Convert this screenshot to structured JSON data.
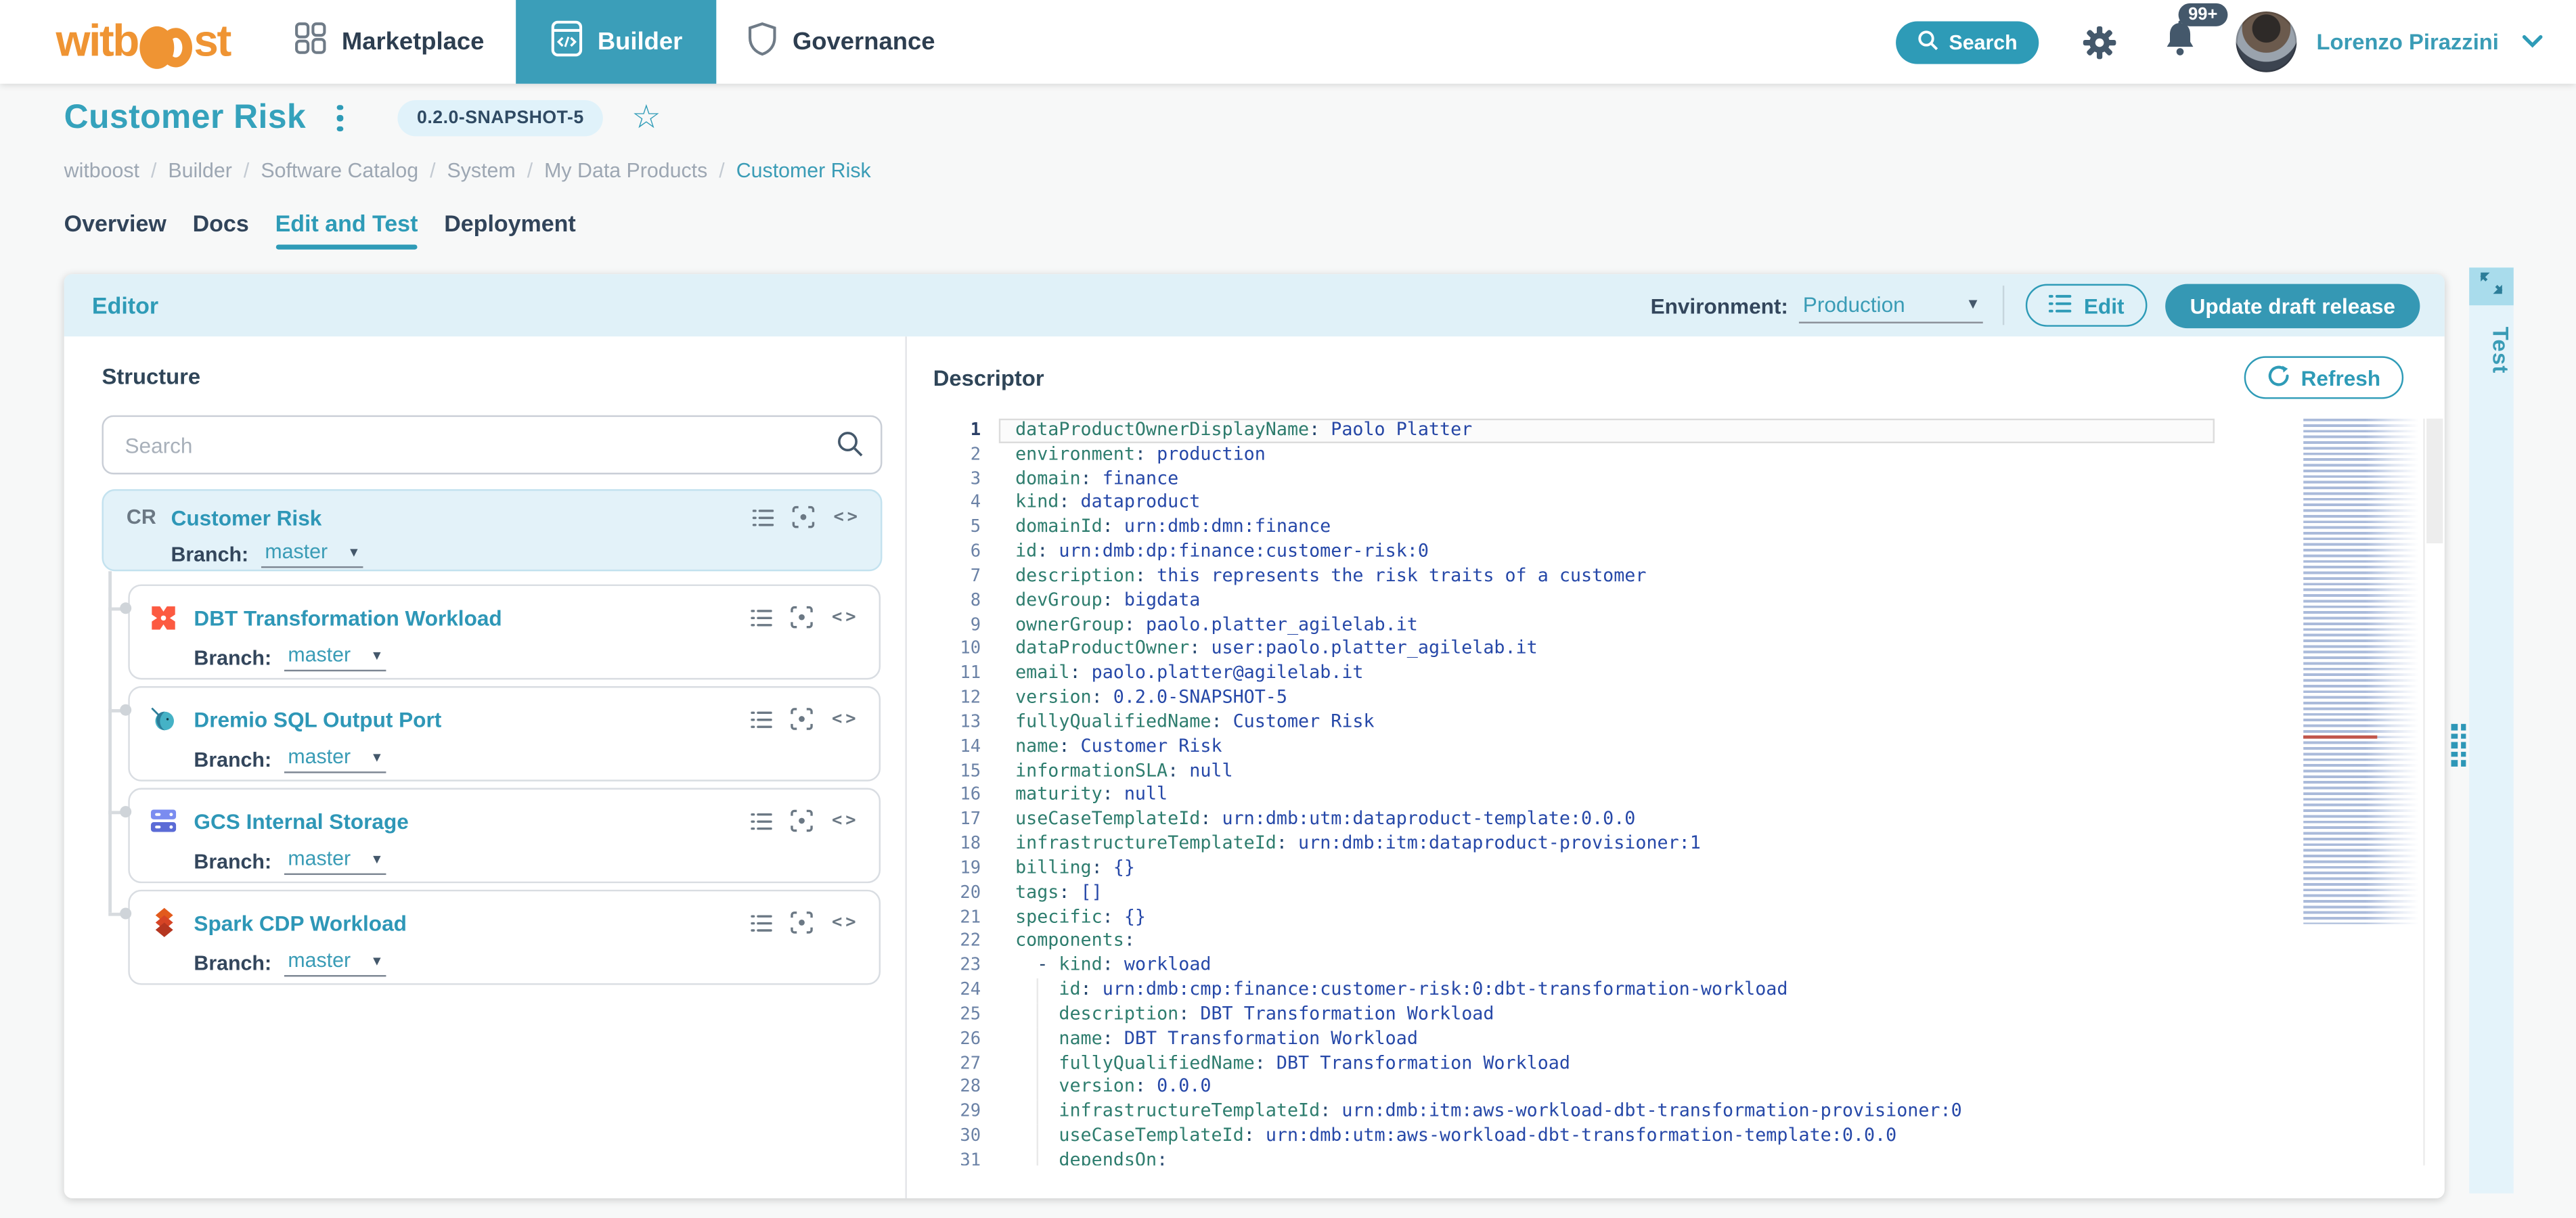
{
  "colors": {
    "accent_teal": "#2e9bb7",
    "dark_slate": "#44586b",
    "brand_orange": "#ef9433",
    "editor_header_bg": "#e0f1f8",
    "selected_card_bg": "#e3f2f9",
    "code_key": "#2e7d6e",
    "code_value": "#2648a8",
    "badge_bg": "#e0f2fa"
  },
  "topbar": {
    "logo_text_left": "witb",
    "logo_text_right": "st",
    "nav": [
      {
        "label": "Marketplace",
        "icon": "grid-icon",
        "active": false
      },
      {
        "label": "Builder",
        "icon": "code-window-icon",
        "active": true
      },
      {
        "label": "Governance",
        "icon": "shield-icon",
        "active": false
      }
    ],
    "search_label": "Search",
    "notifications_badge": "99+",
    "user_name": "Lorenzo Pirazzini"
  },
  "page_header": {
    "title": "Customer Risk",
    "version_badge": "0.2.0-SNAPSHOT-5",
    "breadcrumb": [
      "witboost",
      "Builder",
      "Software Catalog",
      "System",
      "My Data Products",
      "Customer Risk"
    ],
    "tabs": [
      {
        "label": "Overview",
        "active": false
      },
      {
        "label": "Docs",
        "active": false
      },
      {
        "label": "Edit and Test",
        "active": true
      },
      {
        "label": "Deployment",
        "active": false
      }
    ]
  },
  "editor": {
    "title": "Editor",
    "environment_label": "Environment:",
    "environment_value": "Production",
    "edit_button": "Edit",
    "update_button": "Update draft release",
    "test_tab": "Test"
  },
  "structure": {
    "title": "Structure",
    "search_placeholder": "Search",
    "branch_label": "Branch:",
    "root": {
      "abbr": "CR",
      "name": "Customer Risk",
      "branch": "master"
    },
    "children": [
      {
        "name": "DBT Transformation Workload",
        "icon": "dbt-icon",
        "branch": "master"
      },
      {
        "name": "Dremio SQL Output Port",
        "icon": "dremio-icon",
        "branch": "master"
      },
      {
        "name": "GCS Internal Storage",
        "icon": "gcs-icon",
        "branch": "master"
      },
      {
        "name": "Spark CDP Workload",
        "icon": "spark-icon",
        "branch": "master"
      }
    ]
  },
  "descriptor": {
    "title": "Descriptor",
    "refresh_button": "Refresh",
    "code_lines": [
      {
        "num": 1,
        "indent": 0,
        "dash": false,
        "key": "dataProductOwnerDisplayName",
        "value": "Paolo Platter",
        "active": true
      },
      {
        "num": 2,
        "indent": 0,
        "dash": false,
        "key": "environment",
        "value": "production"
      },
      {
        "num": 3,
        "indent": 0,
        "dash": false,
        "key": "domain",
        "value": "finance"
      },
      {
        "num": 4,
        "indent": 0,
        "dash": false,
        "key": "kind",
        "value": "dataproduct"
      },
      {
        "num": 5,
        "indent": 0,
        "dash": false,
        "key": "domainId",
        "value": "urn:dmb:dmn:finance"
      },
      {
        "num": 6,
        "indent": 0,
        "dash": false,
        "key": "id",
        "value": "urn:dmb:dp:finance:customer-risk:0"
      },
      {
        "num": 7,
        "indent": 0,
        "dash": false,
        "key": "description",
        "value": "this represents the risk traits of a customer"
      },
      {
        "num": 8,
        "indent": 0,
        "dash": false,
        "key": "devGroup",
        "value": "bigdata"
      },
      {
        "num": 9,
        "indent": 0,
        "dash": false,
        "key": "ownerGroup",
        "value": "paolo.platter_agilelab.it"
      },
      {
        "num": 10,
        "indent": 0,
        "dash": false,
        "key": "dataProductOwner",
        "value": "user:paolo.platter_agilelab.it"
      },
      {
        "num": 11,
        "indent": 0,
        "dash": false,
        "key": "email",
        "value": "paolo.platter@agilelab.it"
      },
      {
        "num": 12,
        "indent": 0,
        "dash": false,
        "key": "version",
        "value": "0.2.0-SNAPSHOT-5"
      },
      {
        "num": 13,
        "indent": 0,
        "dash": false,
        "key": "fullyQualifiedName",
        "value": "Customer Risk"
      },
      {
        "num": 14,
        "indent": 0,
        "dash": false,
        "key": "name",
        "value": "Customer Risk"
      },
      {
        "num": 15,
        "indent": 0,
        "dash": false,
        "key": "informationSLA",
        "value": "null"
      },
      {
        "num": 16,
        "indent": 0,
        "dash": false,
        "key": "maturity",
        "value": "null"
      },
      {
        "num": 17,
        "indent": 0,
        "dash": false,
        "key": "useCaseTemplateId",
        "value": "urn:dmb:utm:dataproduct-template:0.0.0"
      },
      {
        "num": 18,
        "indent": 0,
        "dash": false,
        "key": "infrastructureTemplateId",
        "value": "urn:dmb:itm:dataproduct-provisioner:1"
      },
      {
        "num": 19,
        "indent": 0,
        "dash": false,
        "key": "billing",
        "value": "{}"
      },
      {
        "num": 20,
        "indent": 0,
        "dash": false,
        "key": "tags",
        "value": "[]"
      },
      {
        "num": 21,
        "indent": 0,
        "dash": false,
        "key": "specific",
        "value": "{}"
      },
      {
        "num": 22,
        "indent": 0,
        "dash": false,
        "key": "components",
        "value": null
      },
      {
        "num": 23,
        "indent": 2,
        "dash": true,
        "key": "kind",
        "value": "workload"
      },
      {
        "num": 24,
        "indent": 4,
        "dash": false,
        "key": "id",
        "value": "urn:dmb:cmp:finance:customer-risk:0:dbt-transformation-workload"
      },
      {
        "num": 25,
        "indent": 4,
        "dash": false,
        "key": "description",
        "value": "DBT Transformation Workload"
      },
      {
        "num": 26,
        "indent": 4,
        "dash": false,
        "key": "name",
        "value": "DBT Transformation Workload"
      },
      {
        "num": 27,
        "indent": 4,
        "dash": false,
        "key": "fullyQualifiedName",
        "value": "DBT Transformation Workload"
      },
      {
        "num": 28,
        "indent": 4,
        "dash": false,
        "key": "version",
        "value": "0.0.0"
      },
      {
        "num": 29,
        "indent": 4,
        "dash": false,
        "key": "infrastructureTemplateId",
        "value": "urn:dmb:itm:aws-workload-dbt-transformation-provisioner:0"
      },
      {
        "num": 30,
        "indent": 4,
        "dash": false,
        "key": "useCaseTemplateId",
        "value": "urn:dmb:utm:aws-workload-dbt-transformation-template:0.0.0"
      },
      {
        "num": 31,
        "indent": 4,
        "dash": false,
        "key": "dependsOn",
        "value": null
      }
    ]
  }
}
